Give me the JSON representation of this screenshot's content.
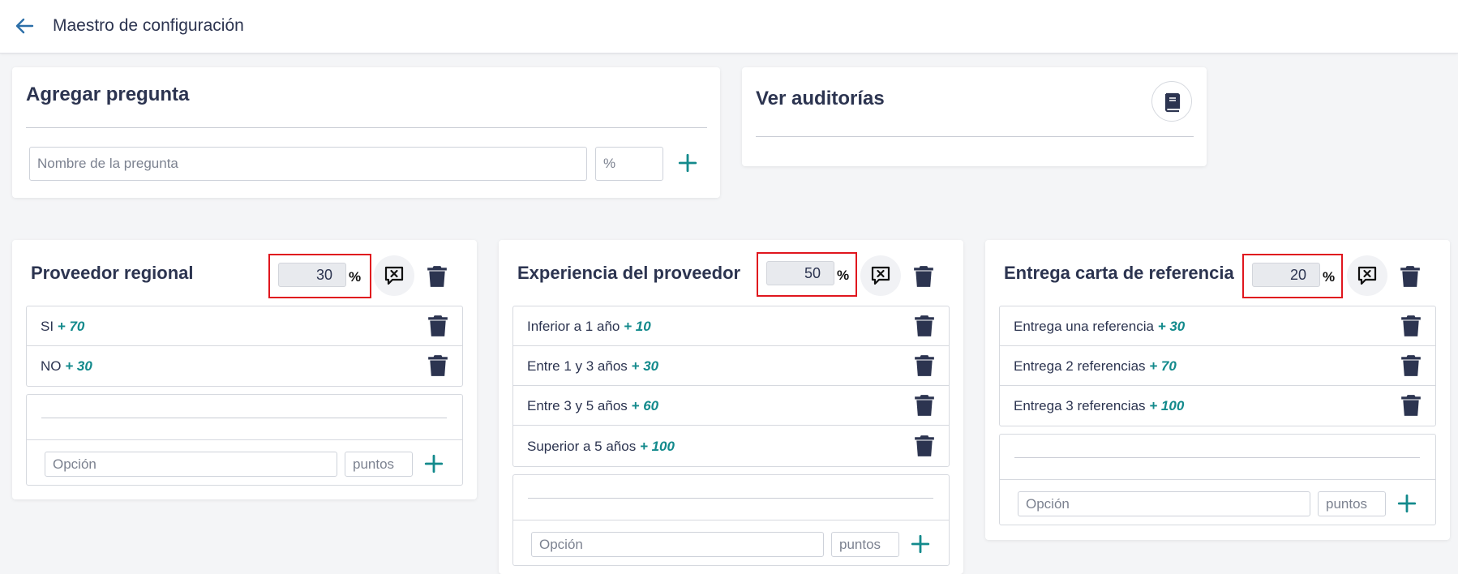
{
  "header": {
    "title": "Maestro de configuración"
  },
  "add_question": {
    "title": "Agregar pregunta",
    "name_placeholder": "Nombre de la pregunta",
    "percent_placeholder": "%"
  },
  "audits": {
    "title": "Ver auditorías"
  },
  "questions": [
    {
      "title": "Proveedor regional",
      "percent": "30",
      "percent_sign": "%",
      "options": [
        {
          "label": "SI",
          "points": "+ 70"
        },
        {
          "label": "NO",
          "points": "+ 30"
        }
      ],
      "new_option_placeholder": "Opción",
      "new_points_placeholder": "puntos"
    },
    {
      "title": "Experiencia del proveedor",
      "percent": "50",
      "percent_sign": "%",
      "options": [
        {
          "label": "Inferior a 1 año",
          "points": "+ 10"
        },
        {
          "label": "Entre 1 y 3 años",
          "points": "+ 30"
        },
        {
          "label": "Entre 3 y 5 años",
          "points": "+ 60"
        },
        {
          "label": "Superior a 5 años",
          "points": "+ 100"
        }
      ],
      "new_option_placeholder": "Opción",
      "new_points_placeholder": "puntos"
    },
    {
      "title": "Entrega carta de referencia",
      "percent": "20",
      "percent_sign": "%",
      "options": [
        {
          "label": "Entrega una referencia",
          "points": "+ 30"
        },
        {
          "label": "Entrega 2 referencias",
          "points": "+ 70"
        },
        {
          "label": "Entrega 3 referencias",
          "points": "+ 100"
        }
      ],
      "new_option_placeholder": "Opción",
      "new_points_placeholder": "puntos"
    }
  ],
  "colors": {
    "accent": "#138a8c",
    "text": "#2c3450",
    "highlight": "#e0161e"
  }
}
